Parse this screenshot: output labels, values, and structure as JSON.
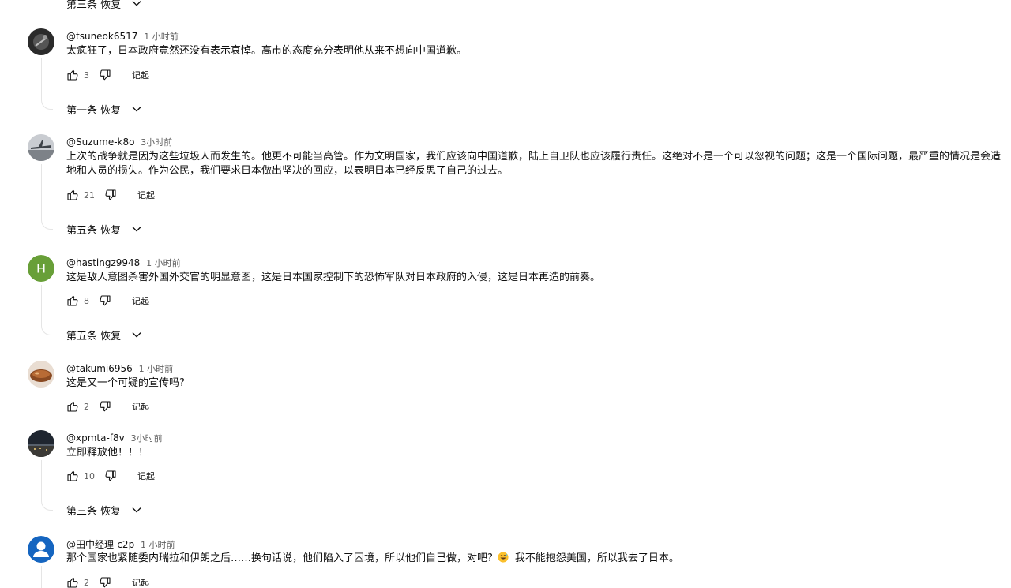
{
  "top_toggle": {
    "label": "第三条 恢复"
  },
  "comments": [
    {
      "handle": "@tsuneok6517",
      "time": "1 小时前",
      "lines": [
        "太疯狂了，日本政府竟然还没有表示哀悼。高市的态度充分表明他从来不想向中国道歉。"
      ],
      "likes": "3",
      "reply_label": "记起",
      "replies_toggle": "第一条 恢复",
      "avatar_icon": "dark-photo-avatar"
    },
    {
      "handle": "@Suzume-k8o",
      "time": "3小时前",
      "lines": [
        "上次的战争就是因为这些垃圾人而发生的。他更不可能当高管。作为文明国家，我们应该向中国道歉，陆上自卫队也应该履行责任。这绝对不是一个可以忽视的问题；这是一个国际问题，最严重的情况是会造",
        "地和人员的损失。作为公民，我们要求日本做出坚决的回应，以表明日本已经反思了自己的过去。"
      ],
      "likes": "21",
      "reply_label": "记起",
      "replies_toggle": "第五条 恢复",
      "avatar_icon": "aircraft-photo-avatar"
    },
    {
      "handle": "@hastingz9948",
      "time": "1 小时前",
      "lines": [
        "这是敌人意图杀害外国外交官的明显意图，这是日本国家控制下的恐怖军队对日本政府的入侵，这是日本再造的前奏。"
      ],
      "likes": "8",
      "reply_label": "记起",
      "replies_toggle": "第五条 恢复",
      "avatar_letter": "H",
      "avatar_color": "#689f38"
    },
    {
      "handle": "@takumi6956",
      "time": "1 小时前",
      "lines": [
        "这是又一个可疑的宣传吗?"
      ],
      "likes": "2",
      "reply_label": "记起",
      "avatar_icon": "food-photo-avatar"
    },
    {
      "handle": "@xpmta-f8v",
      "time": "3小时前",
      "lines": [
        "立即释放他！！！"
      ],
      "likes": "10",
      "reply_label": "记起",
      "replies_toggle": "第三条 恢复",
      "avatar_icon": "night-city-photo-avatar"
    },
    {
      "handle": "@田中经理-c2p",
      "time": "1 小时前",
      "lines": [
        "那个国家也紧随委内瑞拉和伊朗之后……换句话说，他们陷入了困境，所以他们自己做，对吧?"
      ],
      "line_tail": "我不能抱怨美国，所以我去了日本。",
      "likes": "2",
      "reply_label": "记起",
      "avatar_icon": "default-user-avatar",
      "emoji_icon": "grinning-sweat-emoji"
    }
  ],
  "colors": {
    "text": "#0f0f0f",
    "secondary": "#606060",
    "thread_line": "#e5e5e5",
    "default_avatar": "#1565c0"
  }
}
